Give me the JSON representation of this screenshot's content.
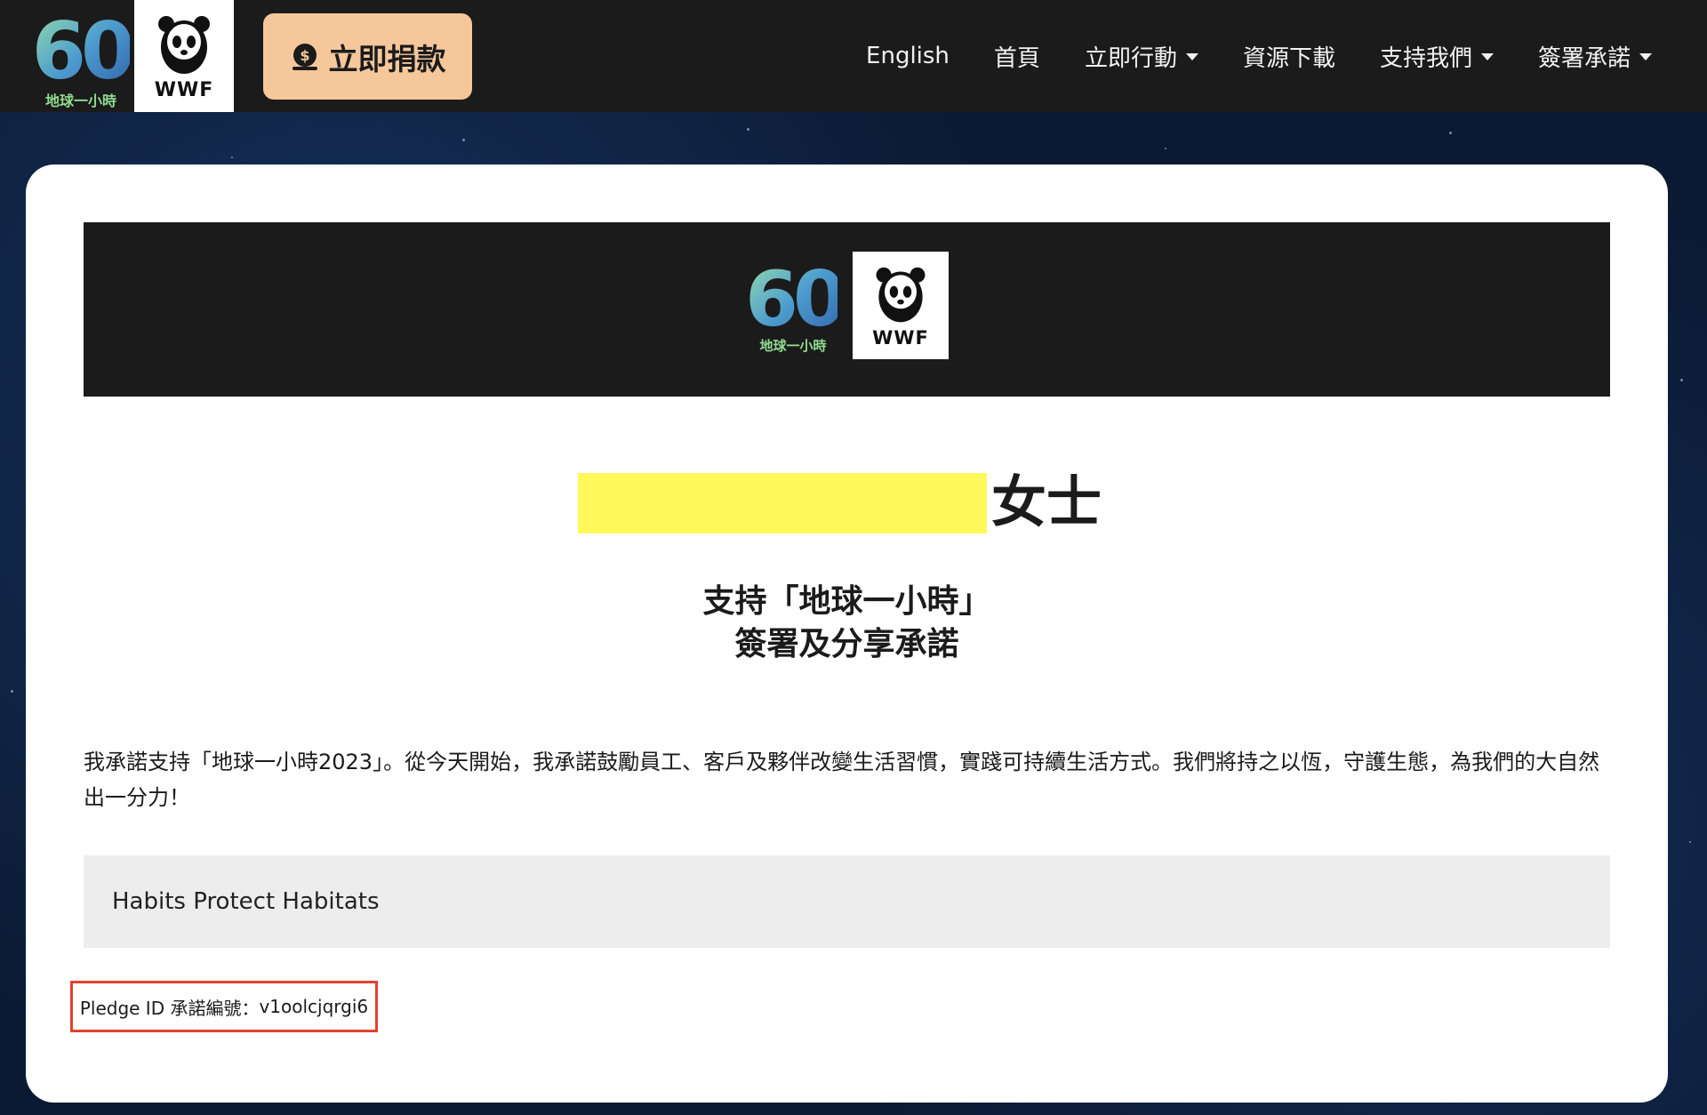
{
  "header": {
    "logo_60_caption": "地球一小時",
    "wwf_label": "WWF",
    "donate_label": "立即捐款",
    "nav": [
      {
        "label": "English",
        "has_dropdown": false
      },
      {
        "label": "首頁",
        "has_dropdown": false
      },
      {
        "label": "立即行動",
        "has_dropdown": true
      },
      {
        "label": "資源下載",
        "has_dropdown": false
      },
      {
        "label": "支持我們",
        "has_dropdown": true
      },
      {
        "label": "簽署承諾",
        "has_dropdown": true
      }
    ]
  },
  "card": {
    "banner_logo_caption": "地球一小時",
    "banner_wwf_label": "WWF",
    "honorific": "女士",
    "subtitle_line1": "支持「地球一小時」",
    "subtitle_line2": "簽署及分享承諾",
    "pledge_text": "我承諾支持「地球一小時2023」。從今天開始，我承諾鼓勵員工、客戶及夥伴改變生活習慣，實踐可持續生活方式。我們將持之以恆，守護生態，為我們的大自然出一分力！",
    "habit_text": "Habits Protect Habitats",
    "pledge_id_label": "Pledge ID 承諾編號：",
    "pledge_id_value": "v1oolcjqrgi6"
  },
  "colors": {
    "nav_bg": "#1b1b1b",
    "donate_bg": "#f6c79a",
    "redaction": "#fdf95a",
    "highlight_border": "#e2412e",
    "sky": "#0b1a33"
  },
  "icons": {
    "donate": "money-bag-icon",
    "dropdown": "caret-down-icon",
    "panda": "panda-icon"
  }
}
